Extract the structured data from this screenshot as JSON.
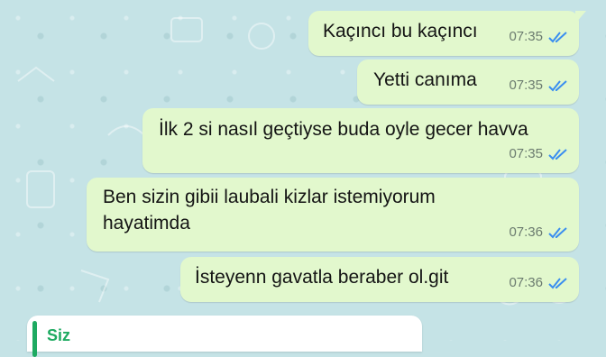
{
  "messages": [
    {
      "text": "Kaçıncı bu kaçıncı",
      "time": "07:35",
      "status": "read"
    },
    {
      "text": "Yetti canıma",
      "time": "07:35",
      "status": "read"
    },
    {
      "text": "İlk 2 si nasıl geçtiyse buda oyle gecer havva",
      "time": "07:35",
      "status": "read"
    },
    {
      "text": "Ben sizin gibii laubali kizlar istemiyorum hayatimda",
      "time": "07:36",
      "status": "read"
    },
    {
      "text": "İsteyenn gavatla beraber ol.git",
      "time": "07:36",
      "status": "read"
    }
  ],
  "incoming_preview": {
    "sender": "Siz"
  },
  "colors": {
    "outgoing_bubble": "#e2f8cd",
    "wallpaper": "#c5e3e6",
    "read_ticks": "#3a8ef0",
    "quote_accent": "#1eaa61"
  },
  "icons": {
    "read_receipt": "double-check-icon"
  }
}
